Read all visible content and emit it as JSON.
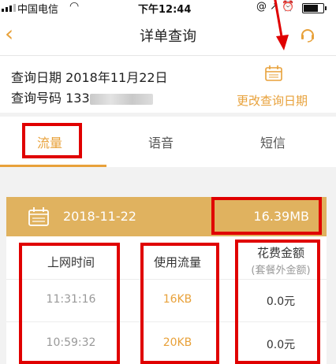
{
  "status_bar": {
    "carrier": "中国电信",
    "time": "下午12:44"
  },
  "nav": {
    "title": "详单查询"
  },
  "info": {
    "date_label": "查询日期",
    "date_value": "2018年11月22日",
    "number_label": "查询号码",
    "number_prefix": "133",
    "change_date_label": "更改查询日期"
  },
  "tabs": [
    {
      "label": "流量",
      "active": true
    },
    {
      "label": "语音",
      "active": false
    },
    {
      "label": "短信",
      "active": false
    }
  ],
  "summary": {
    "date": "2018-11-22",
    "total": "16.39MB"
  },
  "table": {
    "headers": {
      "time": "上网时间",
      "usage": "使用流量",
      "fee": "花费金额",
      "fee_sub": "(套餐外金额)"
    },
    "rows": [
      {
        "time": "11:31:16",
        "usage": "16KB",
        "fee": "0.0元"
      },
      {
        "time": "10:59:32",
        "usage": "20KB",
        "fee": "0.0元"
      }
    ]
  },
  "colors": {
    "accent": "#e8a13a",
    "summary_bg": "#e0b25f",
    "highlight_box": "#e00000"
  }
}
